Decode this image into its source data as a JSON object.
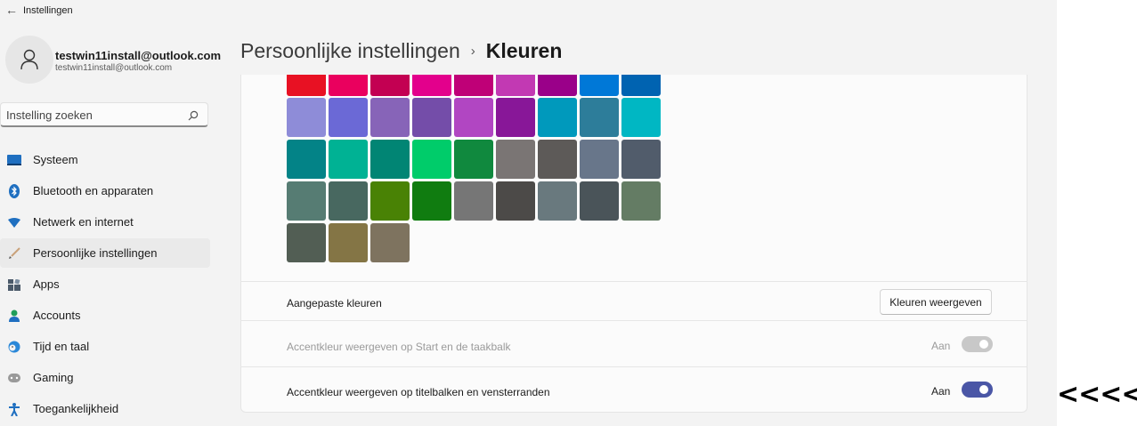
{
  "window": {
    "title": "Instellingen",
    "back_icon": "back-arrow-icon"
  },
  "user": {
    "name": "testwin11install@outlook.com",
    "email": "testwin11install@outlook.com"
  },
  "search": {
    "placeholder": "Instelling zoeken"
  },
  "nav": {
    "items": [
      {
        "label": "Systeem",
        "icon": "monitor-icon",
        "color": "#0067c0"
      },
      {
        "label": "Bluetooth en apparaten",
        "icon": "bluetooth-icon",
        "color": "#0067c0"
      },
      {
        "label": "Netwerk en internet",
        "icon": "wifi-icon",
        "color": "#0067c0"
      },
      {
        "label": "Persoonlijke instellingen",
        "icon": "brush-icon",
        "color": "#e0a56a",
        "selected": true
      },
      {
        "label": "Apps",
        "icon": "apps-icon",
        "color": "#5a6a7a"
      },
      {
        "label": "Accounts",
        "icon": "person-icon",
        "color": "#2bb673"
      },
      {
        "label": "Tijd en taal",
        "icon": "globe-clock-icon",
        "color": "#0067c0"
      },
      {
        "label": "Gaming",
        "icon": "gamepad-icon",
        "color": "#8a8a8a"
      },
      {
        "label": "Toegankelijkheid",
        "icon": "accessibility-icon",
        "color": "#0067c0"
      }
    ]
  },
  "header": {
    "parent": "Persoonlijke instellingen",
    "separator": "›",
    "current": "Kleuren"
  },
  "swatches": [
    [
      "#e81123",
      "#ea005e",
      "#c30052",
      "#e3008c",
      "#bf0077",
      "#c239b3",
      "#9a0089",
      "#0078d7",
      "#0063b1"
    ],
    [
      "#8e8cd8",
      "#6b69d6",
      "#8764b8",
      "#744da9",
      "#b146c2",
      "#881798",
      "#0099bc",
      "#2d7d9a",
      "#00b7c3"
    ],
    [
      "#038387",
      "#00b294",
      "#018574",
      "#00cc6a",
      "#10893e",
      "#7a7574",
      "#5d5a58",
      "#68768a",
      "#515c6b"
    ],
    [
      "#567c73",
      "#486860",
      "#498205",
      "#107c10",
      "#767676",
      "#4c4a48",
      "#69797e",
      "#4a5459",
      "#647c64"
    ],
    [
      "#525e54",
      "#847545",
      "#7e735f"
    ]
  ],
  "custom_colors": {
    "label": "Aangepaste kleuren",
    "button": "Kleuren weergeven"
  },
  "accent_start": {
    "label": "Accentkleur weergeven op Start en de taakbalk",
    "state": "Aan",
    "enabled": false
  },
  "accent_titlebars": {
    "label": "Accentkleur weergeven op titelbalken en vensterranden",
    "state": "Aan",
    "enabled": true
  },
  "annotation": "<<<<",
  "colors": {
    "accent": "#4a56a6",
    "window_bg": "#f3f3f3",
    "card_bg": "#fbfbfb"
  }
}
